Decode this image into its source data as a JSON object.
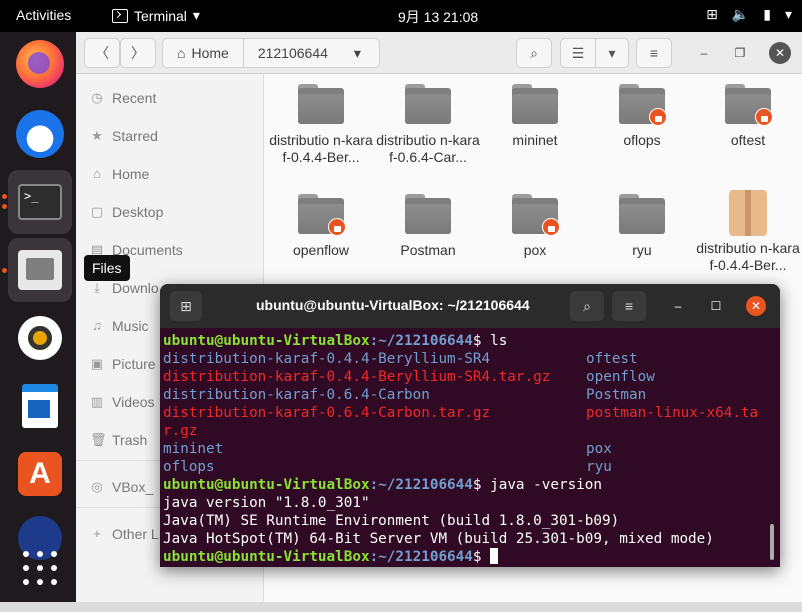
{
  "topbar": {
    "activities": "Activities",
    "app_name": "Terminal",
    "clock": "9月 13  21:08"
  },
  "dock": {
    "tooltip": "Files"
  },
  "files": {
    "breadcrumb": [
      "Home",
      "212106644"
    ],
    "sidebar": [
      "Recent",
      "Starred",
      "Home",
      "Desktop",
      "Documents",
      "Downlo",
      "Music",
      "Picture",
      "Videos",
      "Trash",
      "VBox_",
      "Other L"
    ],
    "items": [
      {
        "label": "distributio n-karaf-0.4.4-Ber...",
        "lock": false
      },
      {
        "label": "distributio n-karaf-0.6.4-Car...",
        "lock": false
      },
      {
        "label": "mininet",
        "lock": false
      },
      {
        "label": "oflops",
        "lock": true
      },
      {
        "label": "oftest",
        "lock": true
      },
      {
        "label": "openflow",
        "lock": true
      },
      {
        "label": "Postman",
        "lock": false
      },
      {
        "label": "pox",
        "lock": true
      },
      {
        "label": "ryu",
        "lock": false
      },
      {
        "label": "distributio n-karaf-0.4.4-Ber...",
        "lock": false
      }
    ]
  },
  "terminal": {
    "title": "ubuntu@ubuntu-VirtualBox: ~/212106644",
    "prompt_user": "ubuntu@ubuntu-VirtualBox",
    "prompt_path": ":~/212106644",
    "cmd1": "$ ls",
    "cmd2": "$ java -version",
    "prompt_end": "$ ",
    "ls_rows": [
      {
        "a": "distribution-karaf-0.4.4-Beryllium-SR4",
        "a_type": "dir",
        "b": "oftest",
        "b_type": "dir"
      },
      {
        "a": "distribution-karaf-0.4.4-Beryllium-SR4.tar.gz",
        "a_type": "arc",
        "b": "openflow",
        "b_type": "dir"
      },
      {
        "a": "distribution-karaf-0.6.4-Carbon",
        "a_type": "dir",
        "b": "Postman",
        "b_type": "dir"
      },
      {
        "a": "distribution-karaf-0.6.4-Carbon.tar.gz",
        "a_type": "arc",
        "b": "postman-linux-x64.ta",
        "b_type": "arc"
      },
      {
        "a": "r.gz",
        "a_type": "arc",
        "b": "",
        "b_type": "dir"
      },
      {
        "a": "mininet",
        "a_type": "dir",
        "b": "pox",
        "b_type": "dir"
      },
      {
        "a": "oflops",
        "a_type": "dir",
        "b": "ryu",
        "b_type": "dir"
      }
    ],
    "java_lines": [
      "java version \"1.8.0_301\"",
      "Java(TM) SE Runtime Environment (build 1.8.0_301-b09)",
      "Java HotSpot(TM) 64-Bit Server VM (build 25.301-b09, mixed mode)"
    ]
  }
}
